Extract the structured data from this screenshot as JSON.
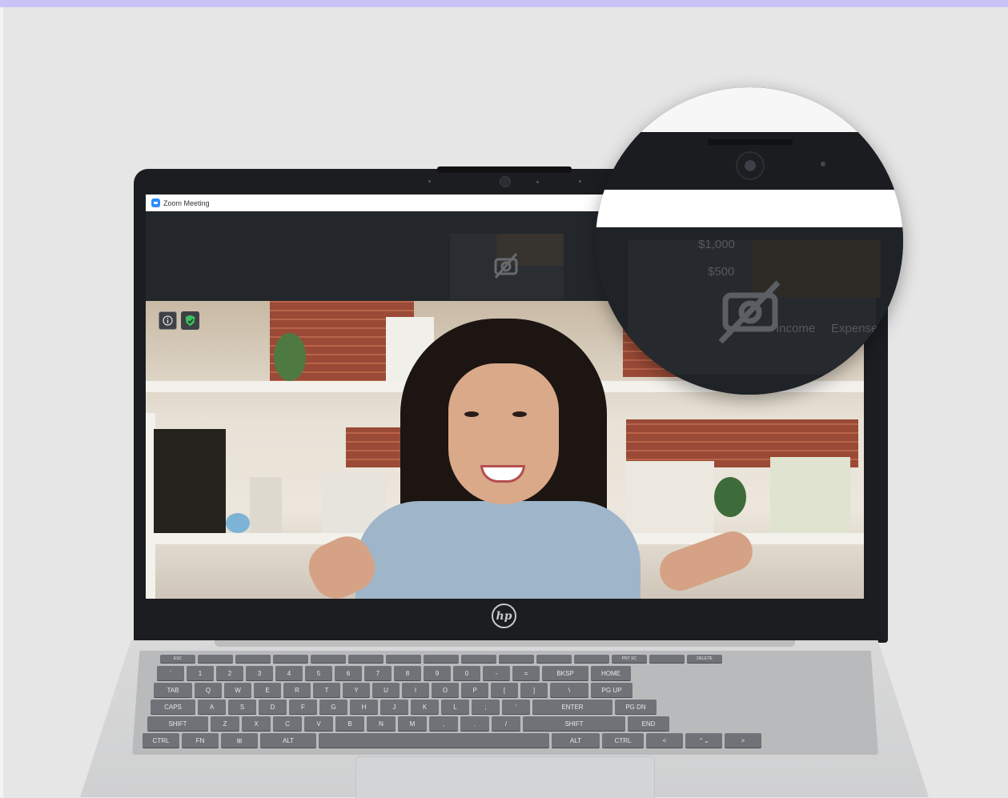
{
  "window": {
    "app_title": "Zoom Meeting"
  },
  "video_controls": {
    "info_icon": "info-icon",
    "security_icon": "shield-check-icon",
    "camera_off_icon": "camera-off-icon"
  },
  "magnifier": {
    "axis_labels": [
      "$1,000",
      "$500"
    ],
    "legend": [
      "Income",
      "Expense"
    ]
  },
  "laptop": {
    "brand_logo": "hp"
  },
  "keyboard": {
    "row1": [
      "`",
      "1",
      "2",
      "3",
      "4",
      "5",
      "6",
      "7",
      "8",
      "9",
      "0",
      "-",
      "=",
      "BKSP",
      "HOME"
    ],
    "row2": [
      "TAB",
      "Q",
      "W",
      "E",
      "R",
      "T",
      "Y",
      "U",
      "I",
      "O",
      "P",
      "[",
      "]",
      "\\",
      "PG UP"
    ],
    "row3": [
      "CAPS",
      "A",
      "S",
      "D",
      "F",
      "G",
      "H",
      "J",
      "K",
      "L",
      ";",
      "'",
      "ENTER",
      "PG DN"
    ],
    "row4": [
      "SHIFT",
      "Z",
      "X",
      "C",
      "V",
      "B",
      "N",
      "M",
      ",",
      ".",
      "/",
      "SHIFT",
      "END"
    ],
    "row5": [
      "CTRL",
      "FN",
      "⊞",
      "ALT",
      "",
      "ALT",
      "CTRL",
      "<",
      "⌃⌄",
      ">"
    ],
    "fn_row": [
      "ESC",
      "",
      "",
      "",
      "",
      "",
      "",
      "",
      "",
      "",
      "",
      "",
      "PRT SC",
      "",
      "DELETE"
    ]
  },
  "colors": {
    "page_bg": "#e6e6e6",
    "top_stripe": "#c9c3f7",
    "zoom_blue": "#2d8cff",
    "shield_green": "#3fbf5f"
  }
}
